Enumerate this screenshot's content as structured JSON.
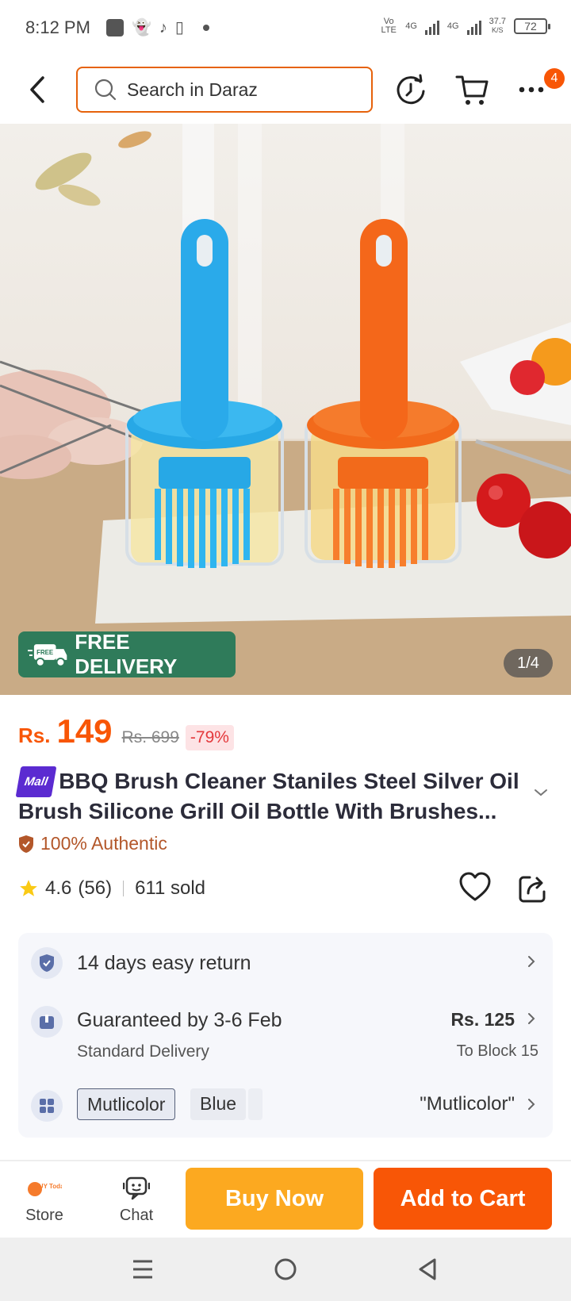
{
  "status_bar": {
    "time": "8:12 PM",
    "network_1": "4G",
    "network_2": "4G",
    "volte": "Vo LTE",
    "speed_value": "37.7",
    "speed_unit": "K/S",
    "battery": "72"
  },
  "nav": {
    "search_placeholder": "Search in Daraz",
    "cart_badge": "4"
  },
  "gallery": {
    "badge_small": "FREE",
    "free_delivery": "FREE DELIVERY",
    "counter": "1/4"
  },
  "price": {
    "currency": "Rs.",
    "value": "149",
    "original": "Rs. 699",
    "discount": "-79%"
  },
  "product": {
    "mall_badge": "Mall",
    "title": "BBQ Brush Cleaner Staniles Steel Silver Oil Brush Silicone Grill Oil Bottle With Brushes...",
    "authentic": "100% Authentic",
    "rating": "4.6",
    "reviews": "(56)",
    "sold": "611 sold"
  },
  "info": {
    "return_text": "14 days easy return",
    "delivery_text": "Guaranteed by 3-6 Feb",
    "delivery_sub": "Standard Delivery",
    "delivery_price": "Rs. 125",
    "delivery_location": "To Block 15",
    "variants": [
      "Mutlicolor",
      "Blue"
    ],
    "selected_variant": "\"Mutlicolor\""
  },
  "bottom_bar": {
    "store_label": "Store",
    "store_logo_text": "BUY Today",
    "chat_label": "Chat",
    "buy_now": "Buy Now",
    "add_to_cart": "Add to Cart"
  },
  "colors": {
    "brand_orange": "#f85606",
    "buy_now": "#fca920",
    "free_delivery_bg": "#2f7b5a",
    "mall_purple": "#5b2bd1"
  }
}
